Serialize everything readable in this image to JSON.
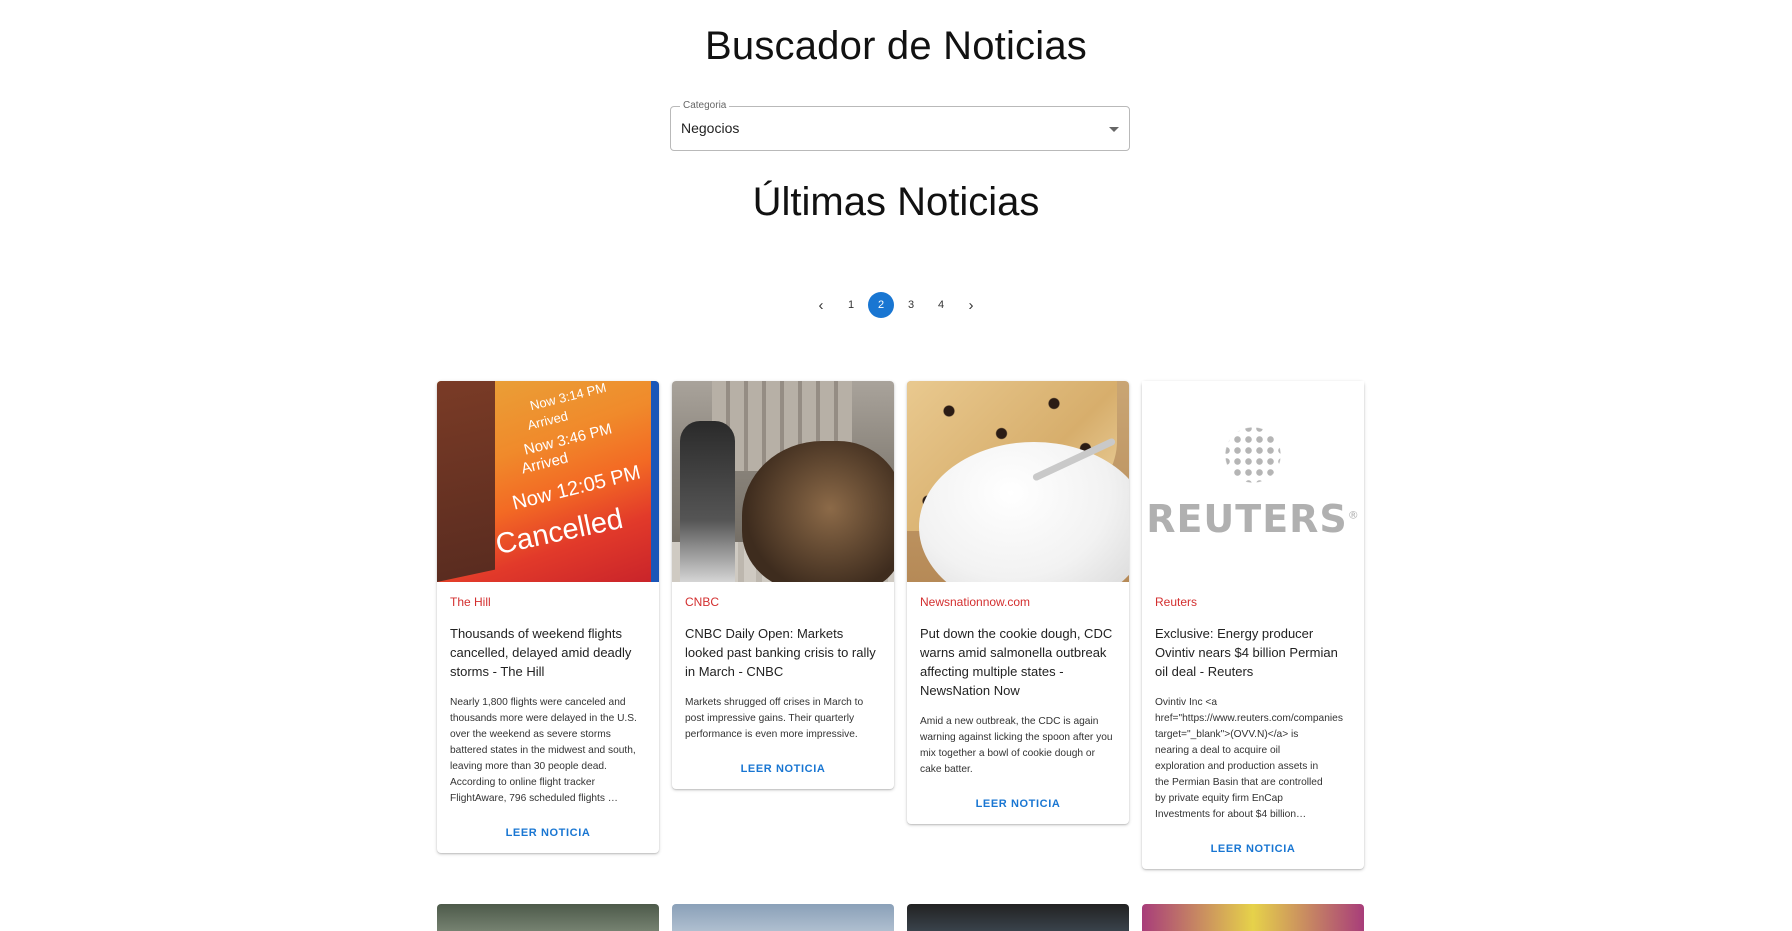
{
  "header": {
    "title": "Buscador de Noticias"
  },
  "category": {
    "label": "Categoria",
    "value": "Negocios"
  },
  "section": {
    "title": "Últimas Noticias"
  },
  "pagination": {
    "prev_icon": "‹",
    "next_icon": "›",
    "pages": [
      "1",
      "2",
      "3",
      "4"
    ],
    "current": "2"
  },
  "colors": {
    "accent": "#1976d2",
    "source": "#d32f2f"
  },
  "articles": [
    {
      "source": "The Hill",
      "title": "Thousands of weekend flights cancelled, delayed amid deadly storms - The Hill",
      "description": "Nearly 1,800 flights were canceled and thousands more were delayed in the U.S. over the weekend as severe storms battered states in the midwest and south, leaving more than 30 people dead. According to online flight tracker FlightAware, 796 scheduled flights …",
      "link": "LEER NOTICIA",
      "image_text": {
        "line1": "Now 3:14 PM",
        "line2": "Arrived",
        "line3": "Now 3:46 PM",
        "line4": "Arrived",
        "line5": "Now 12:05 PM",
        "line6": "Cancelled"
      }
    },
    {
      "source": "CNBC",
      "title": "CNBC Daily Open: Markets looked past banking crisis to rally in March - CNBC",
      "description": "Markets shrugged off crises in March to post impressive gains. Their quarterly performance is even more impressive.",
      "link": "LEER NOTICIA"
    },
    {
      "source": "Newsnationnow.com",
      "title": "Put down the cookie dough, CDC warns amid salmonella outbreak affecting multiple states - NewsNation Now",
      "description": "Amid a new outbreak, the CDC is again warning against licking the spoon after you mix together a bowl of cookie dough or cake batter.",
      "link": "LEER NOTICIA"
    },
    {
      "source": "Reuters",
      "title": "Exclusive: Energy producer Ovintiv nears $4 billion Permian oil deal - Reuters",
      "description_lines": [
        "Ovintiv Inc <a",
        "href=\"https://www.reuters.com/companies",
        "target=\"_blank\">(OVV.N)</a> is",
        "nearing a deal to acquire oil",
        "exploration and production assets in",
        "the Permian Basin that are controlled",
        "by private equity firm EnCap",
        "Investments for about $4 billion…"
      ],
      "link": "LEER NOTICIA",
      "logo_text": "REUTERS",
      "logo_mark": "®"
    }
  ]
}
